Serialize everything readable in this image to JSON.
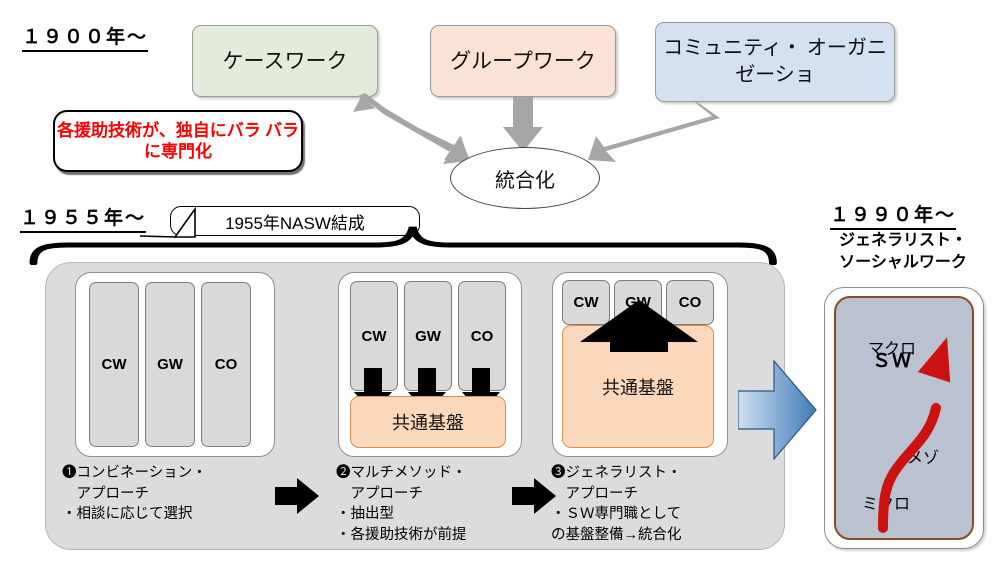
{
  "eras": {
    "e1900": "１９００年～",
    "e1955": "１９５５年～",
    "e1990": "１９９０年～"
  },
  "top_methods": [
    {
      "label": "ケースワーク",
      "color": "#e3ecdb",
      "name": "casework"
    },
    {
      "label": "グループワーク",
      "color": "#fae3d6",
      "name": "groupwork"
    },
    {
      "label": "コミュニティ・\nオーガニゼーショ",
      "color": "#d5e0f0",
      "name": "community-organization"
    }
  ],
  "red_note": "各援助技術が、独自にバラ\nバラに専門化",
  "integration_label": "統合化",
  "nasw_callout": "1955年NASW結成",
  "stages": [
    {
      "number": "❶",
      "title": "コンビネーション・\n　アプローチ",
      "bullets": "・相談に応じて選択",
      "chips": [
        "CW",
        "GW",
        "CO"
      ],
      "base_label": null
    },
    {
      "number": "❷",
      "title": "マルチメソッド・\n　アプローチ",
      "bullets": "・抽出型\n・各援助技術が前提",
      "chips": [
        "CW",
        "GW",
        "CO"
      ],
      "base_label": "共通基盤"
    },
    {
      "number": "❸",
      "title": "ジェネラリスト・\n　アプローチ",
      "bullets": "・ＳＷ専門職として\nの基盤整備→統合化",
      "chips": [
        "CW",
        "GW",
        "CO"
      ],
      "base_label": "共通基盤"
    }
  ],
  "generalist": {
    "title": "ジェネラリスト・\nソーシャルワーク",
    "center_label": "ＳＷ",
    "macro": "マクロ",
    "mezzo": "メゾ",
    "micro": "ミクロ"
  },
  "colors": {
    "green_box": "#e3ecdb",
    "peach_box": "#fae3d6",
    "blue_box": "#d5e0f0",
    "stage_panel": "#dcdcdc",
    "chip": "#d9d9d9",
    "common_base": "#fbd7bc",
    "generalist_inner": "#bac2d2",
    "generalist_border": "#8a4b23",
    "red_text": "#ff0000",
    "red_arrow": "#cc1111",
    "blue_arrow": "#4a86c5",
    "grey_arrow": "#a6a6a6"
  },
  "captions": {
    "stage1": "❶コンビネーション・\n　アプローチ\n・相談に応じて選択",
    "stage2": "❷マルチメソッド・\n　アプローチ\n・抽出型\n・各援助技術が前提",
    "stage3": "❸ジェネラリスト・\n　アプローチ\n・ＳＷ専門職として\nの基盤整備→統合化"
  }
}
